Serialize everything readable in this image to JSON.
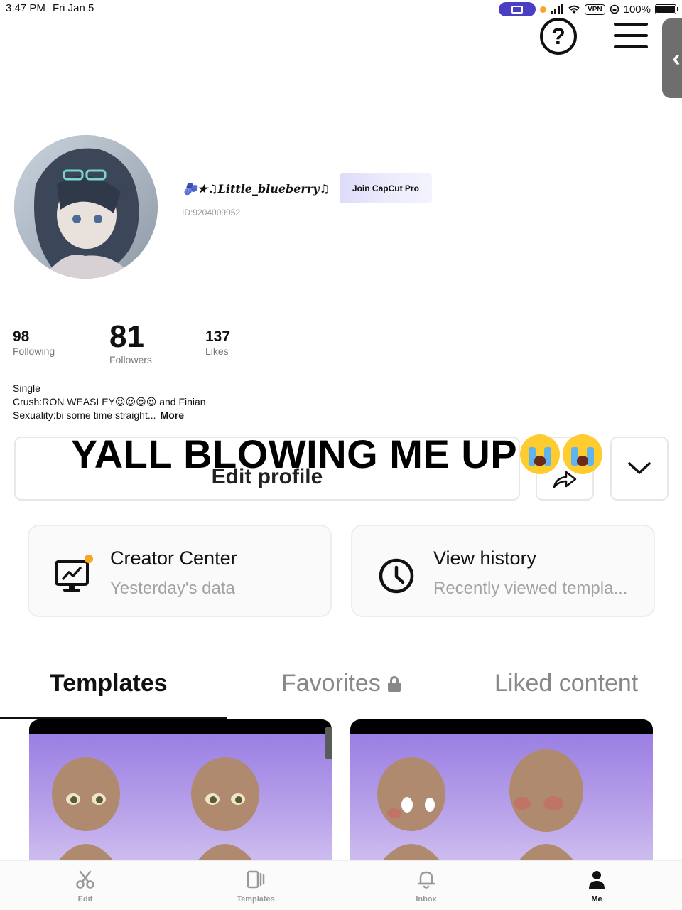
{
  "status_bar": {
    "time": "3:47 PM",
    "date": "Fri Jan 5",
    "vpn_label": "VPN",
    "battery": "100%"
  },
  "profile": {
    "username": "🫐★♫Little_blueberry♫",
    "pro_button": "Join CapCut Pro",
    "user_id": "ID:9204009952"
  },
  "stats": {
    "following_count": "98",
    "following_label": "Following",
    "followers_count": "81",
    "followers_label": "Followers",
    "likes_count": "137",
    "likes_label": "Likes"
  },
  "bio": {
    "line1": "Single",
    "line2": "Crush:RON WEASLEY😍😍😍😍 and Finian",
    "line3": "Sexuality:bi some time straight...",
    "more_label": "More"
  },
  "actions": {
    "edit_profile": "Edit profile"
  },
  "overlay": {
    "caption": "YALL BLOWING ME UP"
  },
  "cards": {
    "creator_title": "Creator Center",
    "creator_sub": "Yesterday's data",
    "history_title": "View history",
    "history_sub": "Recently viewed templa..."
  },
  "tabs": {
    "templates": "Templates",
    "favorites": "Favorites",
    "liked": "Liked content"
  },
  "bottom_nav": {
    "edit": "Edit",
    "templates": "Templates",
    "inbox": "Inbox",
    "me": "Me"
  },
  "colors": {
    "accent_purple": "#4a3fc4",
    "notification_dot": "#f5a623",
    "template_bg": "#9a7fe3"
  }
}
